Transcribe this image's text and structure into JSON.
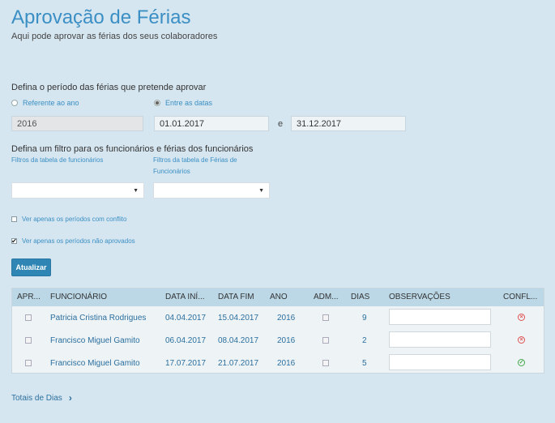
{
  "header": {
    "title": "Aprovação de Férias",
    "subtitle": "Aqui pode aprovar as férias dos seus colaboradores"
  },
  "period": {
    "label": "Defina o período das férias que pretende aprovar",
    "option_year": "Referente ao ano",
    "option_dates": "Entre as datas",
    "selected": "dates",
    "year_value": "2016",
    "date_from": "01.01.2017",
    "date_and": "e",
    "date_to": "31.12.2017"
  },
  "filters": {
    "label": "Defina um filtro para os funcionários e férias dos funcionários",
    "employee_filter_label": "Filtros da tabela de funcionários",
    "vacation_filter_label": "Filtros da tabela de Férias de Funcionários",
    "only_conflicts_label": "Ver apenas os períodos com conflito",
    "only_conflicts_checked": false,
    "only_unapproved_label": "Ver apenas os períodos não aprovados",
    "only_unapproved_checked": true
  },
  "actions": {
    "update_label": "Atualizar"
  },
  "table": {
    "columns": [
      "APR...",
      "FUNCIONÁRIO",
      "DATA INÍ...",
      "DATA FIM",
      "ANO",
      "ADM...",
      "DIAS",
      "OBSERVAÇÕES",
      "CONFL..."
    ],
    "rows": [
      {
        "employee": "Patricia Cristina Rodrigues",
        "start": "04.04.2017",
        "end": "15.04.2017",
        "year": "2016",
        "days": "9",
        "conflict": true
      },
      {
        "employee": "Francisco Miguel Gamito",
        "start": "06.04.2017",
        "end": "08.04.2017",
        "year": "2016",
        "days": "2",
        "conflict": true
      },
      {
        "employee": "Francisco Miguel Gamito",
        "start": "17.07.2017",
        "end": "21.07.2017",
        "year": "2016",
        "days": "5",
        "conflict": false
      }
    ]
  },
  "footer": {
    "totals_label": "Totais de Dias"
  },
  "colors": {
    "accent": "#3b8fc4",
    "button": "#2f86b5",
    "header_row": "#bcd8e7",
    "conflict": "#e05050",
    "ok": "#43a84a"
  }
}
